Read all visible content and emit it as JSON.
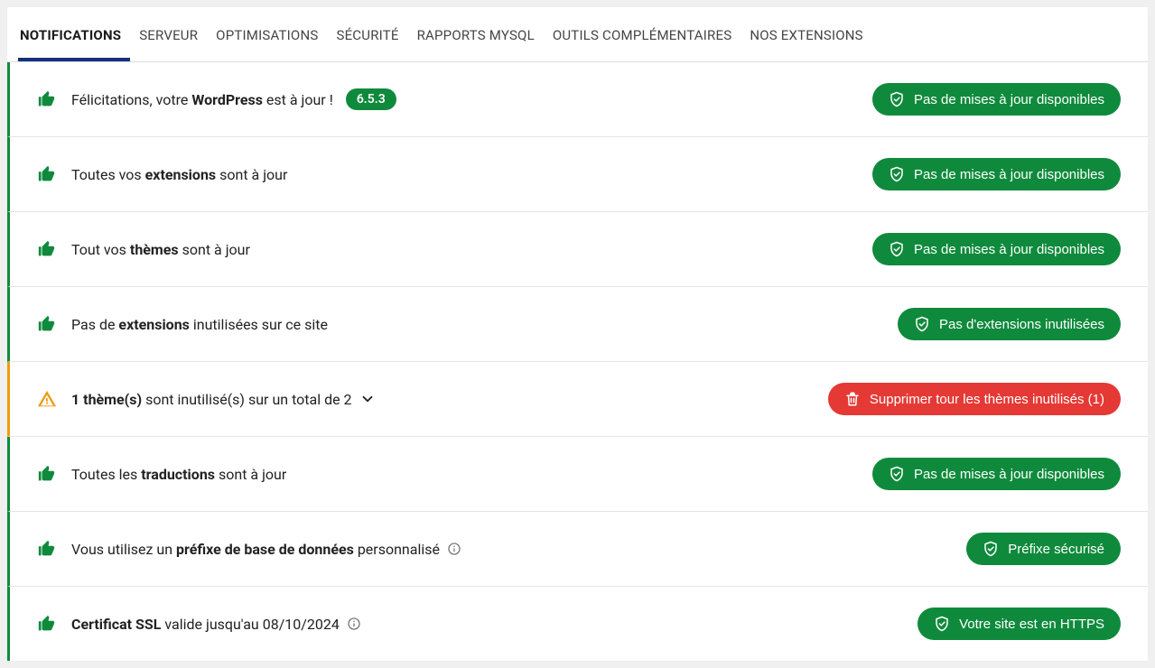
{
  "tabs": [
    {
      "label": "NOTIFICATIONS",
      "active": true
    },
    {
      "label": "SERVEUR",
      "active": false
    },
    {
      "label": "OPTIMISATIONS",
      "active": false
    },
    {
      "label": "SÉCURITÉ",
      "active": false
    },
    {
      "label": "RAPPORTS MYSQL",
      "active": false
    },
    {
      "label": "OUTILS COMPLÉMENTAIRES",
      "active": false
    },
    {
      "label": "NOS EXTENSIONS",
      "active": false
    }
  ],
  "rows": {
    "wp": {
      "pre": "Félicitations, votre ",
      "bold": "WordPress",
      "post": " est à jour !",
      "version": "6.5.3",
      "btn": "Pas de mises à jour disponibles"
    },
    "ext_uptodate": {
      "pre": "Toutes vos ",
      "bold": "extensions",
      "post": " sont à jour",
      "btn": "Pas de mises à jour disponibles"
    },
    "themes_uptodate": {
      "pre": "Tout vos ",
      "bold": "thèmes",
      "post": " sont à jour",
      "btn": "Pas de mises à jour disponibles"
    },
    "ext_unused": {
      "pre": "Pas de ",
      "bold": "extensions",
      "post": " inutilisées sur ce site",
      "btn": "Pas d'extensions inutilisées"
    },
    "themes_unused": {
      "bold": "1 thème(s)",
      "post": " sont inutilisé(s) sur un total de 2",
      "btn": "Supprimer tour les thèmes inutilisés (1)"
    },
    "translations": {
      "pre": "Toutes les ",
      "bold": "traductions",
      "post": " sont à jour",
      "btn": "Pas de mises à jour disponibles"
    },
    "prefix": {
      "pre": "Vous utilisez un ",
      "bold": "préfixe de base de données",
      "post": " personnalisé",
      "btn": "Préfixe sécurisé"
    },
    "ssl": {
      "bold": "Certificat SSL",
      "post": " valide jusqu'au 08/10/2024",
      "btn": "Votre site est en HTTPS"
    }
  }
}
